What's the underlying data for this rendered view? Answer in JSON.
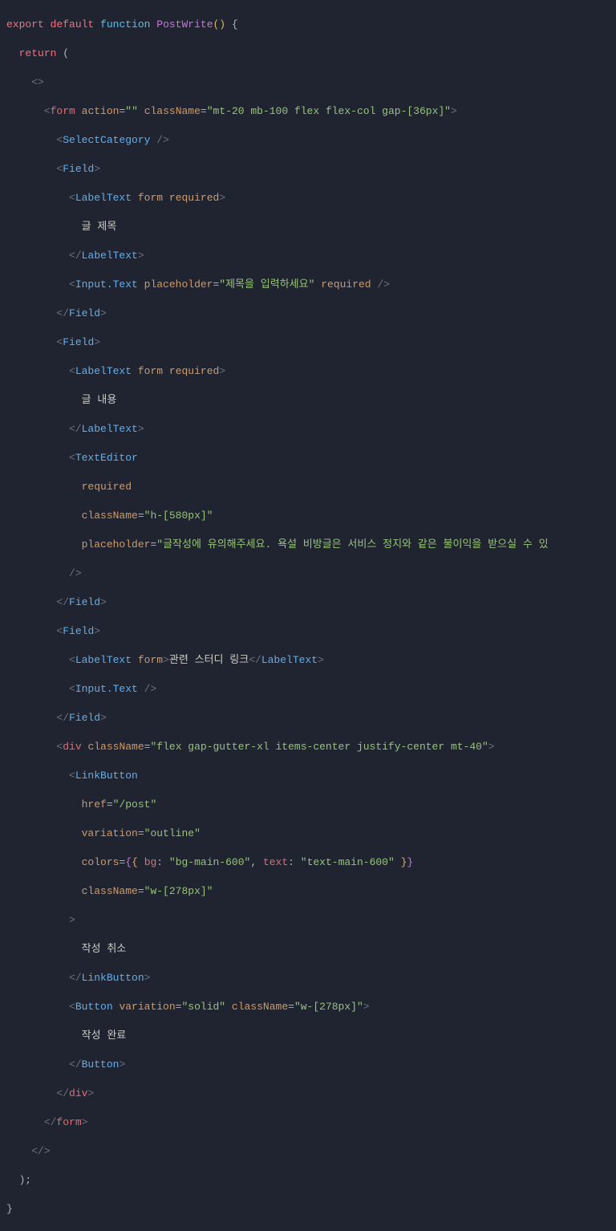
{
  "code": {
    "declaration": {
      "export": "export",
      "default": "default",
      "function": "function",
      "name": "PostWrite",
      "parens": "()",
      "openBrace": " {"
    },
    "returnKw": "return",
    "returnOpen": " (",
    "fragmentOpen": "<>",
    "fragmentClose": "</>",
    "returnClose": ");",
    "closeBrace": "}",
    "form": {
      "tag": "form",
      "action": {
        "name": "action",
        "value": "\"\""
      },
      "className": {
        "name": "className",
        "value": "\"mt-20 mb-100 flex flex-col gap-[36px]\""
      }
    },
    "selectCategory": {
      "tag": "SelectCategory"
    },
    "field1": {
      "tag": "Field",
      "labelText": {
        "tag": "LabelText",
        "attr1": "form",
        "attr2": "required"
      },
      "labelContent": "글 제목",
      "input": {
        "tag": "Input.Text",
        "placeholder": {
          "name": "placeholder",
          "value": "\"제목을 입력하세요\""
        },
        "required": "required"
      }
    },
    "field2": {
      "tag": "Field",
      "labelText": {
        "tag": "LabelText",
        "attr1": "form",
        "attr2": "required"
      },
      "labelContent": "글 내용",
      "textEditor": {
        "tag": "TextEditor",
        "required": "required",
        "className": {
          "name": "className",
          "value": "\"h-[580px]\""
        },
        "placeholder": {
          "name": "placeholder",
          "value": "\"글작성에 유의해주세요. 욕설 비방글은 서비스 정지와 같은 불이익을 받으실 수 있"
        }
      }
    },
    "field3": {
      "tag": "Field",
      "labelText": {
        "tag": "LabelText",
        "attr1": "form"
      },
      "labelContent": "관련 스터디 링크",
      "input": {
        "tag": "Input.Text"
      }
    },
    "buttonDiv": {
      "tag": "div",
      "className": {
        "name": "className",
        "value": "\"flex gap-gutter-xl items-center justify-center mt-40\""
      }
    },
    "linkButton": {
      "tag": "LinkButton",
      "href": {
        "name": "href",
        "value": "\"/post\""
      },
      "variation": {
        "name": "variation",
        "value": "\"outline\""
      },
      "colors": {
        "name": "colors",
        "bgKey": "bg",
        "bgVal": "\"bg-main-600\"",
        "textKey": "text",
        "textVal": "\"text-main-600\""
      },
      "className": {
        "name": "className",
        "value": "\"w-[278px]\""
      },
      "content": "작성 취소"
    },
    "button": {
      "tag": "Button",
      "variation": {
        "name": "variation",
        "value": "\"solid\""
      },
      "className": {
        "name": "className",
        "value": "\"w-[278px]\""
      },
      "content": "작성 완료"
    }
  }
}
